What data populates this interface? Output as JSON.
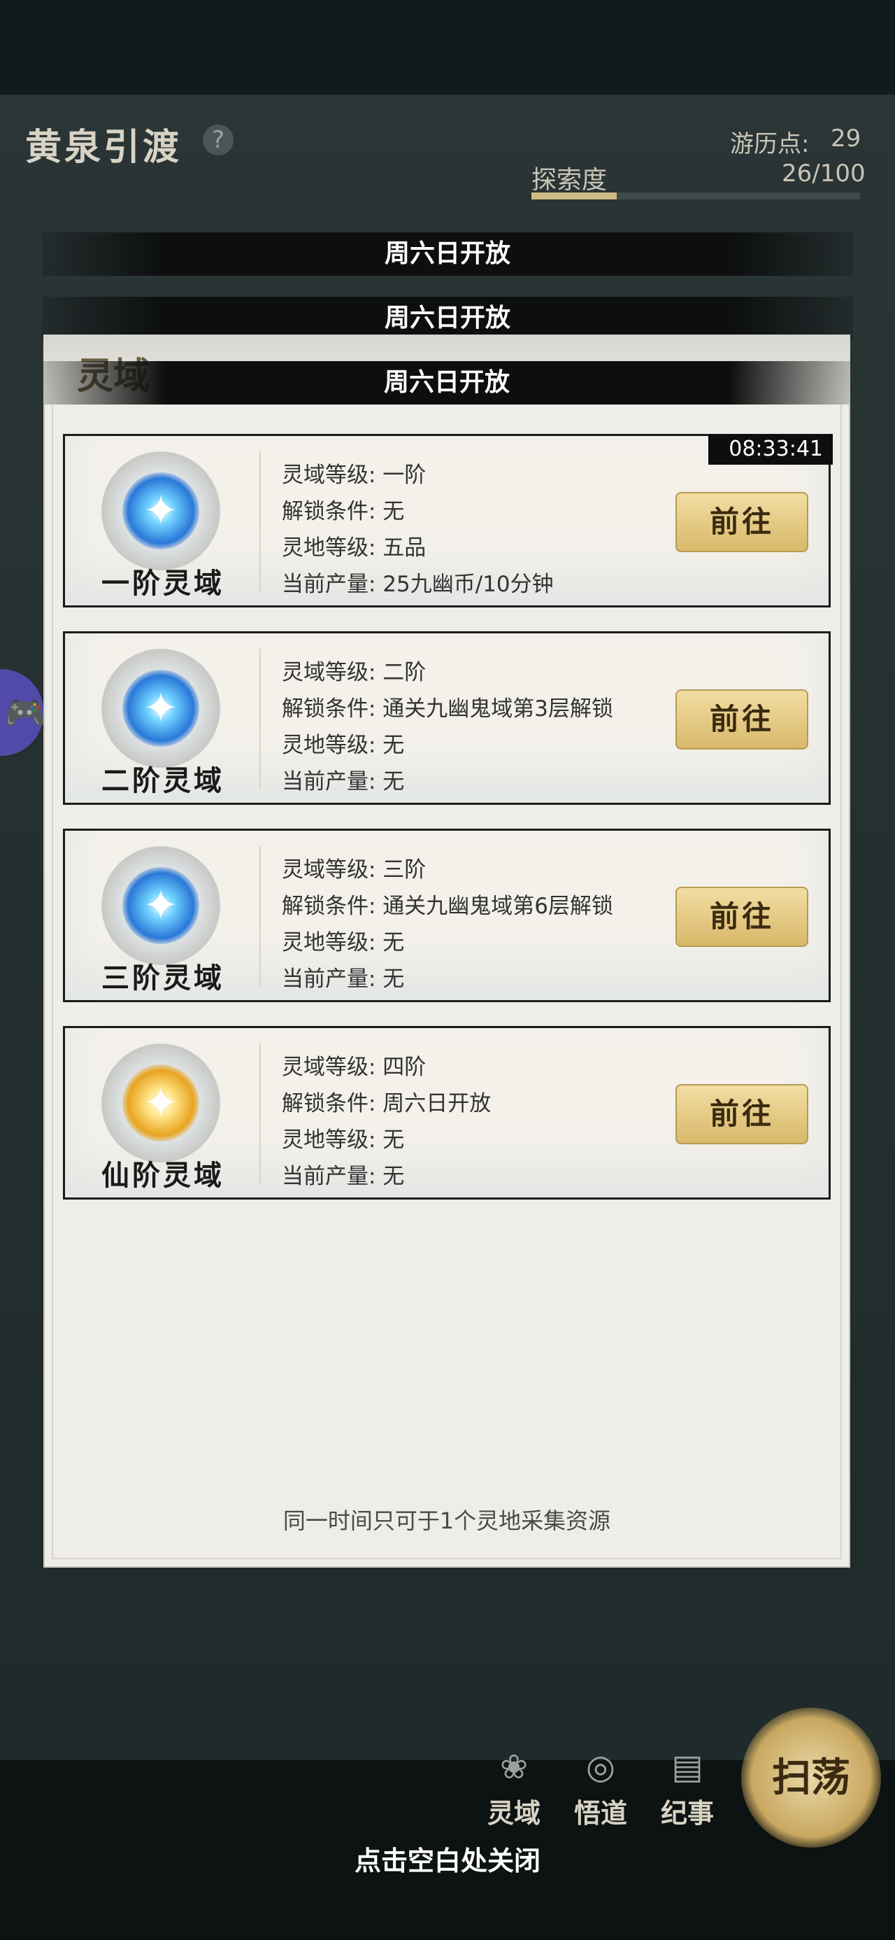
{
  "header": {
    "title": "黄泉引渡",
    "help_icon": "?",
    "travel_points_label": "游历点:",
    "travel_points_value": "29",
    "explore_label": "探索度",
    "explore_value": "26/100",
    "explore_progress": 0.26
  },
  "banners": [
    "周六日开放",
    "周六日开放",
    "周六日开放"
  ],
  "modal": {
    "title": "灵域",
    "footer_note": "同一时间只可于1个灵地采集资源",
    "cards": [
      {
        "name": "一阶灵域",
        "orb": "blue",
        "timer": "08:33:41",
        "lines": [
          "灵域等级: 一阶",
          "解锁条件: 无",
          "灵地等级: 五品",
          "当前产量: 25九幽币/10分钟"
        ],
        "button": "前往"
      },
      {
        "name": "二阶灵域",
        "orb": "blue",
        "lines": [
          "灵域等级: 二阶",
          "解锁条件: 通关九幽鬼域第3层解锁",
          "灵地等级: 无",
          "当前产量: 无"
        ],
        "button": "前往"
      },
      {
        "name": "三阶灵域",
        "orb": "blue",
        "lines": [
          "灵域等级: 三阶",
          "解锁条件: 通关九幽鬼域第6层解锁",
          "灵地等级: 无",
          "当前产量: 无"
        ],
        "button": "前往"
      },
      {
        "name": "仙阶灵域",
        "orb": "gold",
        "lines": [
          "灵域等级: 四阶",
          "解锁条件: 周六日开放",
          "灵地等级: 无",
          "当前产量: 无"
        ],
        "button": "前往"
      }
    ]
  },
  "bottom_nav": [
    {
      "label": "灵域",
      "icon": "lotus-icon"
    },
    {
      "label": "悟道",
      "icon": "swirl-icon"
    },
    {
      "label": "纪事",
      "icon": "book-icon"
    }
  ],
  "sweep_button": "扫荡",
  "close_hint": "点击空白处关闭",
  "colors": {
    "button_gold": "#d9b86a",
    "modal_bg": "#eeede7",
    "orb_blue": "#2a78d8",
    "orb_gold": "#e8a420",
    "gamepad_purple": "#5a4fc0"
  }
}
